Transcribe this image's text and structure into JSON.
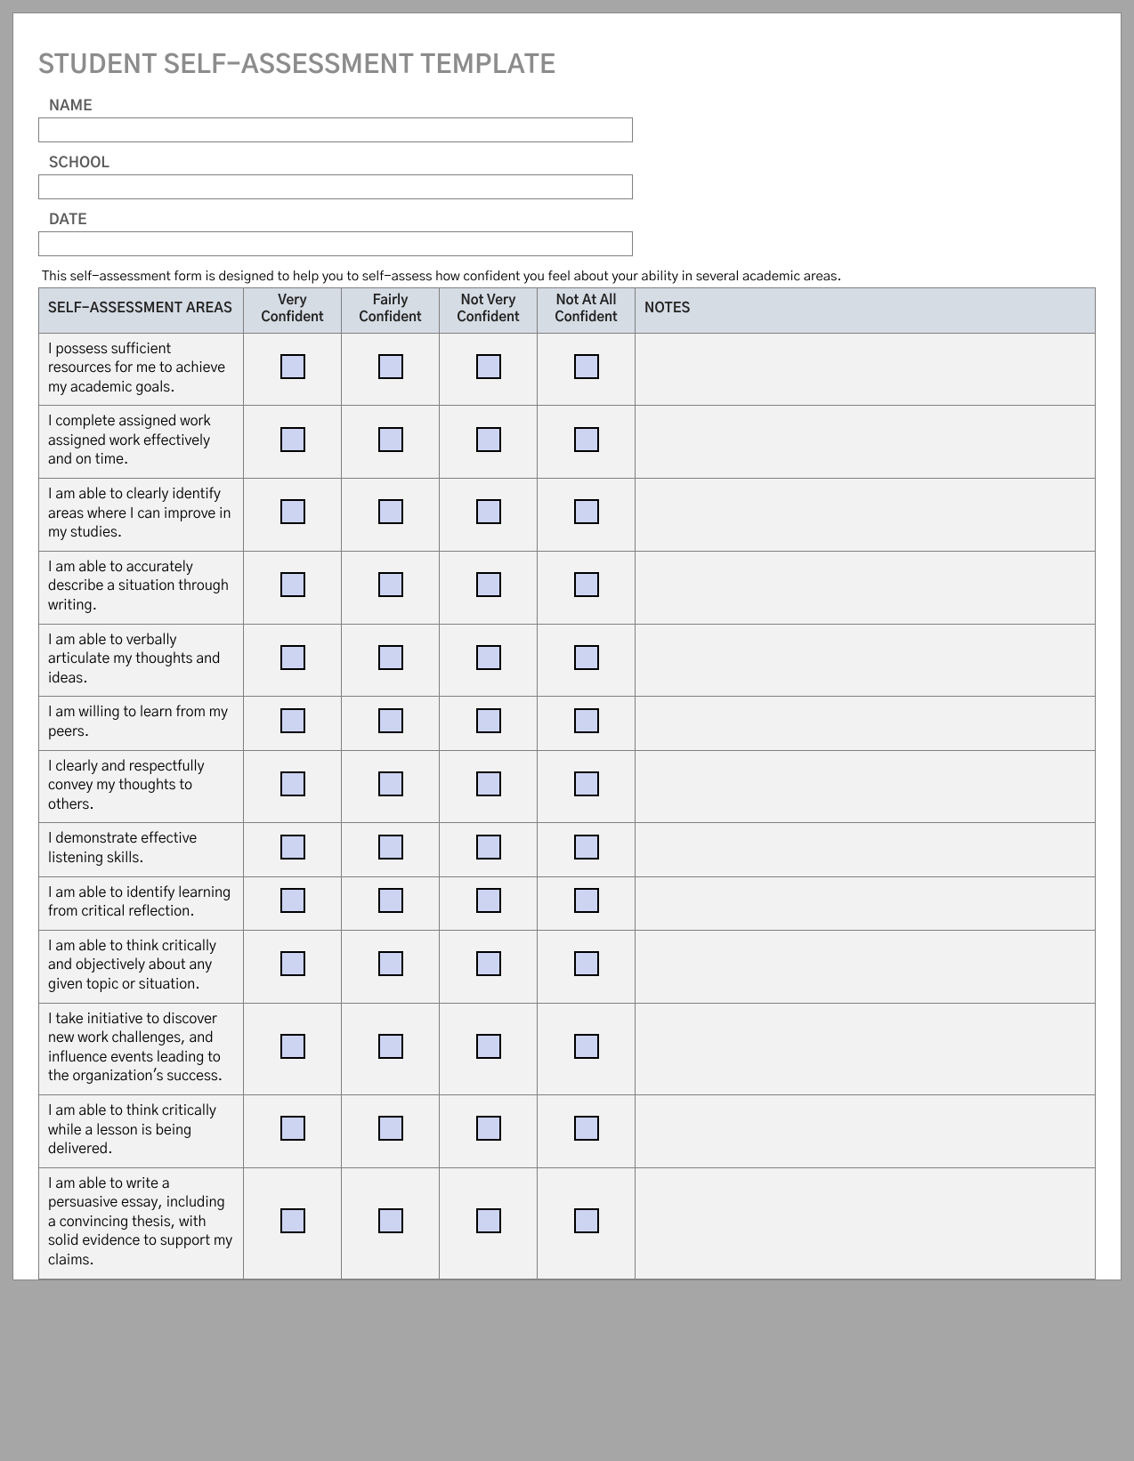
{
  "title": "STUDENT SELF-ASSESSMENT TEMPLATE",
  "fields": {
    "name_label": "NAME",
    "school_label": "SCHOOL",
    "date_label": "DATE",
    "name_value": "",
    "school_value": "",
    "date_value": ""
  },
  "intro": "This self-assessment form is designed to help you to self-assess how confident you feel about your ability in several academic areas.",
  "headers": {
    "areas": "SELF-ASSESSMENT AREAS",
    "very": "Very Confident",
    "fairly": "Fairly Confident",
    "notvery": "Not Very Confident",
    "notatall": "Not At All Confident",
    "notes": "NOTES"
  },
  "items": [
    "I possess sufficient resources for me to achieve my academic goals.",
    "I complete assigned work assigned work effectively and on time.",
    "I am able to clearly identify areas where I can improve in my studies.",
    "I am able to accurately describe a situation through writing.",
    "I am able to verbally articulate my thoughts and ideas.",
    "I am willing to learn from my peers.",
    "I clearly and respectfully convey my thoughts to others.",
    "I demonstrate effective listening skills.",
    "I am able to identify learning from critical reflection.",
    "I am able to think critically and objectively about any given topic or situation.",
    "I take initiative to discover new work challenges, and influence events leading to the organization's success.",
    "I am able to think critically while a lesson is being delivered.",
    "I am able to write a persuasive essay, including a convincing thesis, with solid evidence to support my claims."
  ]
}
